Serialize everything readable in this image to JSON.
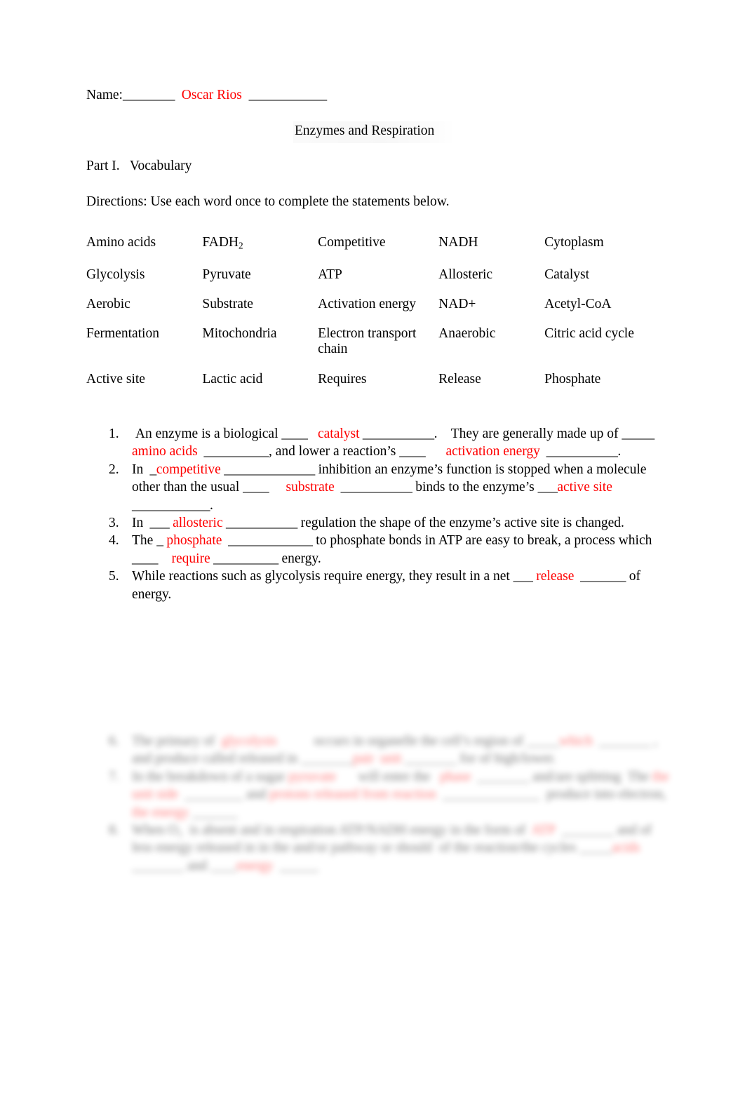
{
  "header": {
    "name_label": "Name:",
    "name_blank_left": "________",
    "student_name": "Oscar Rios",
    "name_blank_right": "____________",
    "title": "Enzymes and Respiration"
  },
  "part": {
    "heading": "Part I.   Vocabulary",
    "directions": "Directions: Use each word once to complete the statements below."
  },
  "word_bank": {
    "rows": [
      [
        "Amino acids",
        "FADH",
        "Competitive",
        "NADH",
        "Cytoplasm"
      ],
      [
        "Glycolysis",
        "Pyruvate",
        "ATP",
        "Allosteric",
        "Catalyst"
      ],
      [
        "Aerobic",
        "Substrate",
        "Activation energy",
        "NAD+",
        "Acetyl-CoA"
      ],
      [
        "Fermentation",
        "Mitochondria",
        "Electron transport chain",
        "Anaerobic",
        "Citric acid cycle"
      ],
      [
        "Active site",
        "Lactic acid",
        "Requires",
        "Release",
        "Phosphate"
      ]
    ],
    "fadh_subscript": "2"
  },
  "questions": [
    {
      "number": "1.",
      "parts": [
        {
          "type": "text",
          "text": " An enzyme is a biological "
        },
        {
          "type": "blank",
          "text": "____"
        },
        {
          "type": "text",
          "text": "   "
        },
        {
          "type": "answer",
          "text": "catalyst"
        },
        {
          "type": "blank",
          "text": " ___________"
        },
        {
          "type": "text",
          "text": ".    They are generally made up of "
        },
        {
          "type": "blank",
          "text": "_____"
        },
        {
          "type": "text",
          "text": " "
        },
        {
          "type": "answer",
          "text": "amino acids"
        },
        {
          "type": "blank",
          "text": "  __________"
        },
        {
          "type": "text",
          "text": ", and lower a reaction’s "
        },
        {
          "type": "blank",
          "text": "____"
        },
        {
          "type": "text",
          "text": "      "
        },
        {
          "type": "answer",
          "text": "activation energy"
        },
        {
          "type": "blank",
          "text": "  ___________"
        },
        {
          "type": "text",
          "text": "."
        }
      ]
    },
    {
      "number": "2.",
      "parts": [
        {
          "type": "text",
          "text": "In "
        },
        {
          "type": "blank",
          "text": " _"
        },
        {
          "type": "answer",
          "text": "competitive"
        },
        {
          "type": "blank",
          "text": " ______________"
        },
        {
          "type": "text",
          "text": " inhibition an enzyme’s function is stopped when a molecule other than the usual "
        },
        {
          "type": "blank",
          "text": "____"
        },
        {
          "type": "text",
          "text": "     "
        },
        {
          "type": "answer",
          "text": "substrate"
        },
        {
          "type": "blank",
          "text": "  ___________"
        },
        {
          "type": "text",
          "text": " binds to the enzyme’s "
        },
        {
          "type": "blank",
          "text": "___"
        },
        {
          "type": "answer",
          "text": "active site"
        },
        {
          "type": "blank",
          "text": "  ____________"
        },
        {
          "type": "text",
          "text": "."
        }
      ]
    },
    {
      "number": "3.",
      "parts": [
        {
          "type": "text",
          "text": "In "
        },
        {
          "type": "blank",
          "text": " ___"
        },
        {
          "type": "text",
          "text": " "
        },
        {
          "type": "answer",
          "text": "allosteric"
        },
        {
          "type": "blank",
          "text": " ___________"
        },
        {
          "type": "text",
          "text": " regulation the shape of the enzyme’s active site is changed."
        }
      ]
    },
    {
      "number": "4.",
      "parts": [
        {
          "type": "text",
          "text": "The "
        },
        {
          "type": "blank",
          "text": "_"
        },
        {
          "type": "text",
          "text": " "
        },
        {
          "type": "answer",
          "text": "phosphate"
        },
        {
          "type": "blank",
          "text": "  _____________"
        },
        {
          "type": "text",
          "text": " to phosphate bonds in ATP are easy to break, a process which "
        },
        {
          "type": "blank",
          "text": "____"
        },
        {
          "type": "text",
          "text": "    "
        },
        {
          "type": "answer",
          "text": "require"
        },
        {
          "type": "blank",
          "text": " __________"
        },
        {
          "type": "text",
          "text": " energy."
        }
      ]
    },
    {
      "number": "5.",
      "parts": [
        {
          "type": "text",
          "text": "While reactions such as glycolysis require energy, they result in a net "
        },
        {
          "type": "blank",
          "text": "___"
        },
        {
          "type": "text",
          "text": " "
        },
        {
          "type": "answer",
          "text": "release"
        },
        {
          "type": "blank",
          "text": "  _______"
        },
        {
          "type": "text",
          "text": " of energy."
        }
      ]
    }
  ],
  "blurred_section": {
    "note": "illegible blurred text",
    "items": [
      {
        "number": "6.",
        "parts": [
          {
            "type": "text",
            "text": "The primary of  "
          },
          {
            "type": "answer",
            "text": "glycolysis"
          },
          {
            "type": "blank",
            "text": "            "
          },
          {
            "type": "text",
            "text": "occurs in organelle the cell’s region of "
          },
          {
            "type": "blank",
            "text": "_____"
          },
          {
            "type": "answer",
            "text": "which"
          },
          {
            "type": "blank",
            "text": "  ________"
          },
          {
            "type": "text",
            "text": " , and produce called released in "
          },
          {
            "type": "blank",
            "text": "________"
          },
          {
            "type": "answer",
            "text": "pair"
          },
          {
            "type": "blank",
            "text": "  "
          },
          {
            "type": "answer",
            "text": "unit"
          },
          {
            "type": "blank",
            "text": " ________"
          },
          {
            "type": "text",
            "text": " for of high/lower."
          }
        ]
      },
      {
        "number": "7.",
        "parts": [
          {
            "type": "text",
            "text": "In the breakdown of a sugar "
          },
          {
            "type": "answer",
            "text": "pyruvate"
          },
          {
            "type": "blank",
            "text": "      "
          },
          {
            "type": "text",
            "text": " will enter the "
          },
          {
            "type": "blank",
            "text": "  "
          },
          {
            "type": "answer",
            "text": "phase"
          },
          {
            "type": "blank",
            "text": "  ________"
          },
          {
            "type": "text",
            "text": " and/are splitting  The "
          },
          {
            "type": "answer",
            "text": "the unit"
          },
          {
            "type": "blank",
            "text": " "
          },
          {
            "type": "answer",
            "text": "side"
          },
          {
            "type": "blank",
            "text": "  _________"
          },
          {
            "type": "text",
            "text": " and "
          },
          {
            "type": "answer",
            "text": "protons released from reaction"
          },
          {
            "type": "blank",
            "text": "  _______________"
          },
          {
            "type": "text",
            "text": "  produce into electron, "
          },
          {
            "type": "answer",
            "text": "the energy"
          },
          {
            "type": "blank",
            "text": " _______"
          }
        ]
      },
      {
        "number": "8.",
        "parts": [
          {
            "type": "text",
            "text": "When O₂  is absent and in respiration ATP/NADH energy in the form "
          },
          {
            "type": "blank",
            "text": "of  "
          },
          {
            "type": "answer",
            "text": "ATP"
          },
          {
            "type": "blank",
            "text": "  ________"
          },
          {
            "type": "text",
            "text": " and of less energy released in in the and/or pathway or should  of the reaction/the cycles "
          },
          {
            "type": "blank",
            "text": "_____"
          },
          {
            "type": "answer",
            "text": "acids"
          },
          {
            "type": "blank",
            "text": "  ________"
          },
          {
            "type": "text",
            "text": " and "
          },
          {
            "type": "blank",
            "text": "____"
          },
          {
            "type": "answer",
            "text": "energy"
          },
          {
            "type": "blank",
            "text": "  ______"
          }
        ]
      }
    ]
  },
  "colors": {
    "answer_red": "#ff0000",
    "text_black": "#000000",
    "page_background": "#ffffff"
  }
}
